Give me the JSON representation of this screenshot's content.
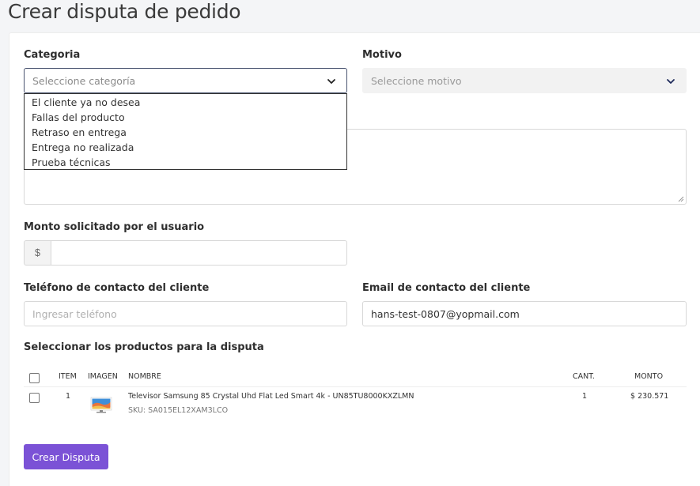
{
  "page": {
    "title": "Crear disputa de pedido"
  },
  "categoria": {
    "label": "Categoria",
    "placeholder": "Seleccione categoría",
    "options": [
      "El cliente ya no desea",
      "Fallas del producto",
      "Retraso en entrega",
      "Entrega no realizada",
      "Prueba técnicas"
    ]
  },
  "motivo": {
    "label": "Motivo",
    "placeholder": "Seleccione motivo"
  },
  "monto": {
    "label": "Monto solicitado por el usuario",
    "currency_symbol": "$",
    "value": ""
  },
  "telefono": {
    "label": "Teléfono de contacto del cliente",
    "placeholder": "Ingresar teléfono"
  },
  "email": {
    "label": "Email de contacto del cliente",
    "value": "hans-test-0807@yopmail.com"
  },
  "productos": {
    "label": "Seleccionar los productos para la disputa",
    "columns": {
      "item": "ITEM",
      "imagen": "IMAGEN",
      "nombre": "NOMBRE",
      "cant": "CANT.",
      "monto": "MONTO"
    },
    "rows": [
      {
        "item": "1",
        "nombre": "Televisor Samsung 85 Crystal Uhd Flat Led Smart 4k - UN85TU8000KXZLMN",
        "sku": "SKU: SA015EL12XAM3LCO",
        "cant": "1",
        "monto": "$ 230.571"
      }
    ]
  },
  "submit": {
    "label": "Crear Disputa"
  },
  "colors": {
    "primary": "#7b52d6",
    "focus_border": "#4a5470",
    "chevron": "#1e2a5a"
  },
  "icons": {
    "select_arrow": "chevron-down-icon",
    "product_thumb": "tv-thumbnail"
  }
}
